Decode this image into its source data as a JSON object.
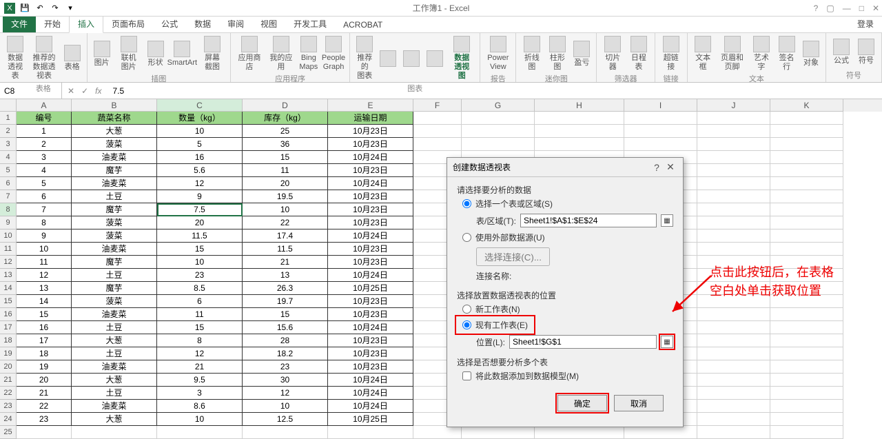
{
  "app_title": "工作簿1 - Excel",
  "login": "登录",
  "tabs": [
    "文件",
    "开始",
    "插入",
    "页面布局",
    "公式",
    "数据",
    "审阅",
    "视图",
    "开发工具",
    "ACROBAT"
  ],
  "active_tab": 2,
  "ribbon_groups": [
    {
      "label": "表格",
      "items": [
        "数据\n透视表",
        "推荐的\n数据透视表",
        "表格"
      ]
    },
    {
      "label": "插图",
      "items": [
        "图片",
        "联机图片",
        "形状",
        "SmartArt",
        "屏幕截图"
      ]
    },
    {
      "label": "应用程序",
      "items": [
        "应用商店",
        "我的应用",
        "Bing\nMaps",
        "People\nGraph"
      ]
    },
    {
      "label": "图表",
      "items": [
        "推荐的\n图表",
        "",
        "",
        "",
        "数据透视图"
      ]
    },
    {
      "label": "报告",
      "items": [
        "Power\nView"
      ]
    },
    {
      "label": "迷你图",
      "items": [
        "折线图",
        "柱形图",
        "盈亏"
      ]
    },
    {
      "label": "筛选器",
      "items": [
        "切片器",
        "日程表"
      ]
    },
    {
      "label": "链接",
      "items": [
        "超链接"
      ]
    },
    {
      "label": "文本",
      "items": [
        "文本框",
        "页眉和页脚",
        "艺术字",
        "签名行",
        "对象"
      ]
    },
    {
      "label": "符号",
      "items": [
        "公式",
        "符号"
      ]
    }
  ],
  "namebox": "C8",
  "formula_value": "7.5",
  "columns": [
    "A",
    "B",
    "C",
    "D",
    "E",
    "F",
    "G",
    "H",
    "I",
    "J",
    "K"
  ],
  "headers": [
    "编号",
    "蔬菜名称",
    "数量（kg）",
    "库存（kg）",
    "运输日期"
  ],
  "selected_cell": {
    "row": 8,
    "col": "C"
  },
  "rows": [
    [
      "1",
      "大葱",
      "10",
      "25",
      "10月23日"
    ],
    [
      "2",
      "菠菜",
      "5",
      "36",
      "10月23日"
    ],
    [
      "3",
      "油麦菜",
      "16",
      "15",
      "10月24日"
    ],
    [
      "4",
      "魔芋",
      "5.6",
      "11",
      "10月23日"
    ],
    [
      "5",
      "油麦菜",
      "12",
      "20",
      "10月24日"
    ],
    [
      "6",
      "土豆",
      "9",
      "19.5",
      "10月23日"
    ],
    [
      "7",
      "魔芋",
      "7.5",
      "10",
      "10月23日"
    ],
    [
      "8",
      "菠菜",
      "20",
      "22",
      "10月23日"
    ],
    [
      "9",
      "菠菜",
      "11.5",
      "17.4",
      "10月24日"
    ],
    [
      "10",
      "油麦菜",
      "15",
      "11.5",
      "10月23日"
    ],
    [
      "11",
      "魔芋",
      "10",
      "21",
      "10月23日"
    ],
    [
      "12",
      "土豆",
      "23",
      "13",
      "10月24日"
    ],
    [
      "13",
      "魔芋",
      "8.5",
      "26.3",
      "10月25日"
    ],
    [
      "14",
      "菠菜",
      "6",
      "19.7",
      "10月23日"
    ],
    [
      "15",
      "油麦菜",
      "11",
      "15",
      "10月23日"
    ],
    [
      "16",
      "土豆",
      "15",
      "15.6",
      "10月24日"
    ],
    [
      "17",
      "大葱",
      "8",
      "28",
      "10月23日"
    ],
    [
      "18",
      "土豆",
      "12",
      "18.2",
      "10月23日"
    ],
    [
      "19",
      "油麦菜",
      "21",
      "23",
      "10月23日"
    ],
    [
      "20",
      "大葱",
      "9.5",
      "30",
      "10月24日"
    ],
    [
      "21",
      "土豆",
      "3",
      "12",
      "10月24日"
    ],
    [
      "22",
      "油麦菜",
      "8.6",
      "10",
      "10月24日"
    ],
    [
      "23",
      "大葱",
      "10",
      "12.5",
      "10月25日"
    ]
  ],
  "dialog": {
    "title": "创建数据透视表",
    "section1_label": "请选择要分析的数据",
    "radio_select_table": "选择一个表或区域(S)",
    "table_range_label": "表/区域(T):",
    "table_range_value": "Sheet1!$A$1:$E$24",
    "radio_external": "使用外部数据源(U)",
    "choose_connection_btn": "选择连接(C)...",
    "connection_label": "连接名称:",
    "section2_label": "选择放置数据透视表的位置",
    "radio_new_sheet": "新工作表(N)",
    "radio_existing_sheet": "现有工作表(E)",
    "location_label": "位置(L):",
    "location_value": "Sheet1!$G$1",
    "section3_label": "选择是否想要分析多个表",
    "chk_add_model": "将此数据添加到数据模型(M)",
    "ok": "确定",
    "cancel": "取消"
  },
  "annotation": "点击此按钮后，在表格\n空白处单击获取位置"
}
